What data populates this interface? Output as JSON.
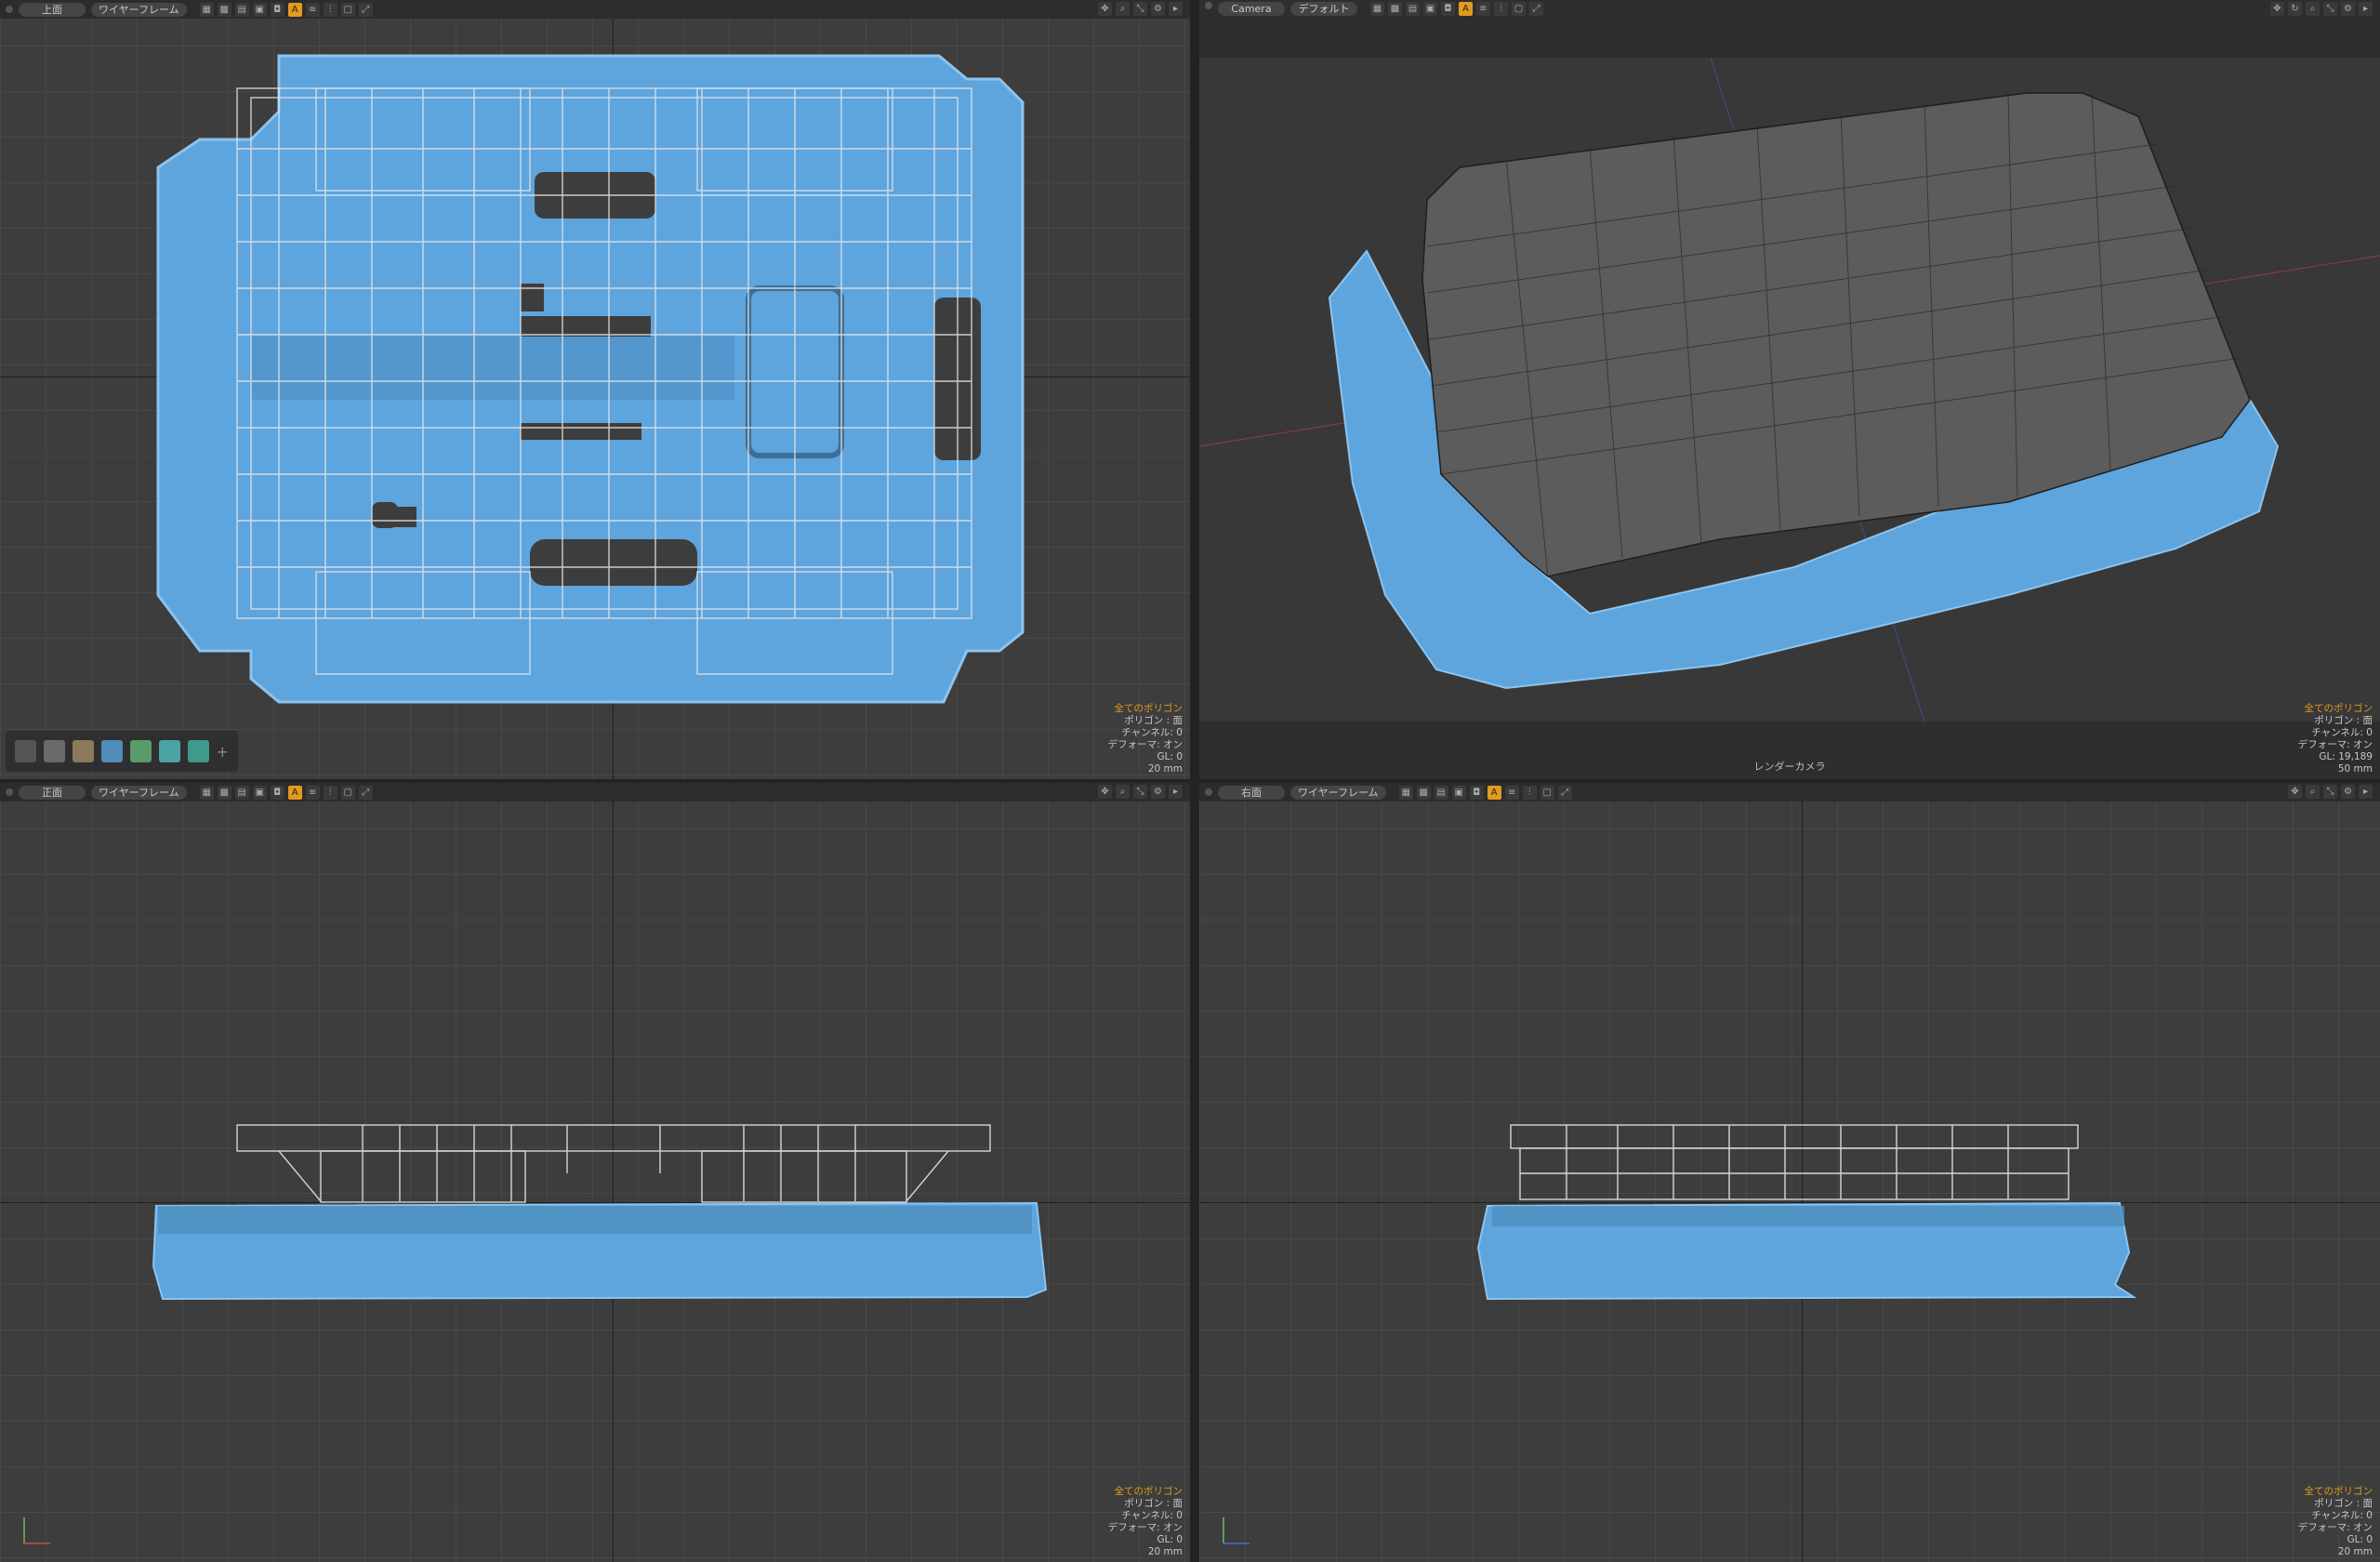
{
  "viewports": {
    "top": {
      "view_label": "上面",
      "shading_label": "ワイヤーフレーム"
    },
    "camera": {
      "view_label": "Camera",
      "shading_label": "デフォルト",
      "camera_name": "レンダーカメラ"
    },
    "front": {
      "view_label": "正面",
      "shading_label": "ワイヤーフレーム"
    },
    "right": {
      "view_label": "右面",
      "shading_label": "ワイヤーフレーム"
    }
  },
  "info_ortho": {
    "line1": "全てのポリゴン",
    "line2": "ポリゴン : 面",
    "line3": "チャンネル: 0",
    "line4": "デフォーマ: オン",
    "line5": "GL: 0",
    "line6": "20 mm"
  },
  "info_camera": {
    "line1": "全てのポリゴン",
    "line2": "ポリゴン : 面",
    "line3": "チャンネル: 0",
    "line4": "デフォーマ: オン",
    "line5": "GL: 19,189",
    "line6": "50 mm"
  },
  "icons": {
    "header_left": [
      "grid-icon",
      "grid4-icon",
      "grid-icon",
      "image-icon",
      "camera-icon",
      "eye-icon",
      "a-icon",
      "lines-icon",
      "sliders-icon",
      "window-icon",
      "expand-icon"
    ],
    "header_right": [
      "move-icon",
      "search-icon",
      "zoom-icon",
      "gear-icon",
      "arrow-right-icon"
    ]
  },
  "colors": {
    "accent": "#e29a1f",
    "pointcloud": "#5ea4dd",
    "viewport_bg": "#3d3d3d"
  }
}
